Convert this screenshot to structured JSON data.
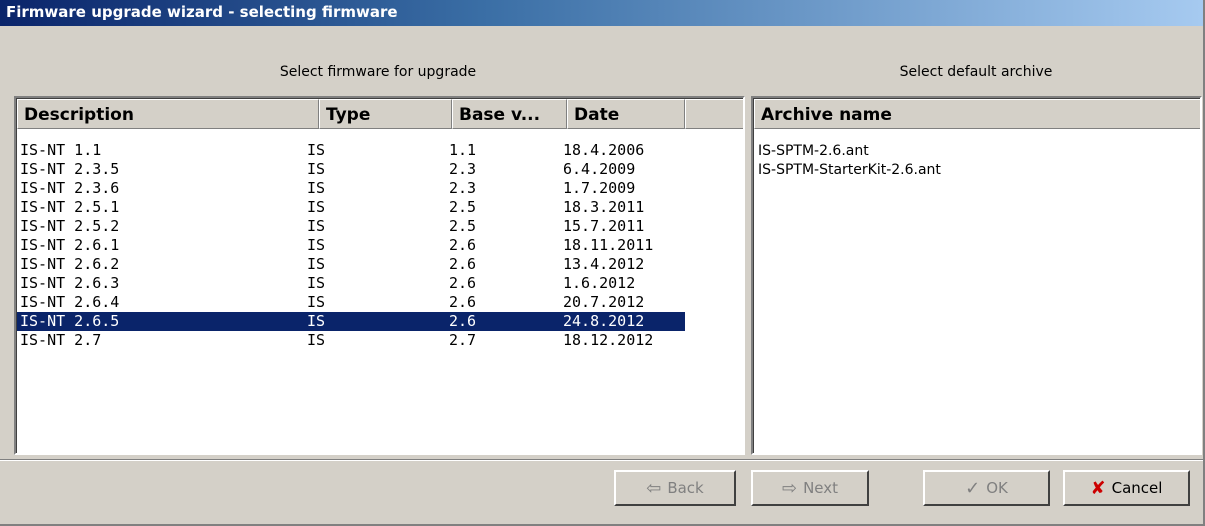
{
  "window": {
    "title": "Firmware upgrade wizard - selecting firmware"
  },
  "firmware_panel": {
    "header": "Select firmware for upgrade",
    "columns": [
      "Description",
      "Type",
      "Base v...",
      "Date"
    ],
    "rows": [
      {
        "description": "IS-NT 1.1",
        "type": "IS",
        "base": "1.1",
        "date": "18.4.2006"
      },
      {
        "description": "IS-NT 2.3.5",
        "type": "IS",
        "base": "2.3",
        "date": "6.4.2009"
      },
      {
        "description": "IS-NT 2.3.6",
        "type": "IS",
        "base": "2.3",
        "date": "1.7.2009"
      },
      {
        "description": "IS-NT 2.5.1",
        "type": "IS",
        "base": "2.5",
        "date": "18.3.2011"
      },
      {
        "description": "IS-NT 2.5.2",
        "type": "IS",
        "base": "2.5",
        "date": "15.7.2011"
      },
      {
        "description": "IS-NT 2.6.1",
        "type": "IS",
        "base": "2.6",
        "date": "18.11.2011"
      },
      {
        "description": "IS-NT 2.6.2",
        "type": "IS",
        "base": "2.6",
        "date": "13.4.2012"
      },
      {
        "description": "IS-NT 2.6.3",
        "type": "IS",
        "base": "2.6",
        "date": "1.6.2012"
      },
      {
        "description": "IS-NT 2.6.4",
        "type": "IS",
        "base": "2.6",
        "date": "20.7.2012"
      },
      {
        "description": "IS-NT 2.6.5",
        "type": "IS",
        "base": "2.6",
        "date": "24.8.2012"
      },
      {
        "description": "IS-NT 2.7",
        "type": "IS",
        "base": "2.7",
        "date": "18.12.2012"
      }
    ],
    "selected_index": 9
  },
  "archive_panel": {
    "header": "Select default archive",
    "column": "Archive name",
    "items": [
      "IS-SPTM-2.6.ant",
      "IS-SPTM-StarterKit-2.6.ant"
    ]
  },
  "buttons": {
    "back": {
      "label": "Back",
      "icon": "arrow-left-icon",
      "enabled": false
    },
    "next": {
      "label": "Next",
      "icon": "arrow-right-icon",
      "enabled": false
    },
    "ok": {
      "label": "OK",
      "icon": "checkmark-icon",
      "enabled": false
    },
    "cancel": {
      "label": "Cancel",
      "icon": "red-x-icon",
      "enabled": true
    }
  },
  "colors": {
    "selection": "#0a246a",
    "title_bar": "#0a246a",
    "cancel_icon": "#cc0000"
  }
}
